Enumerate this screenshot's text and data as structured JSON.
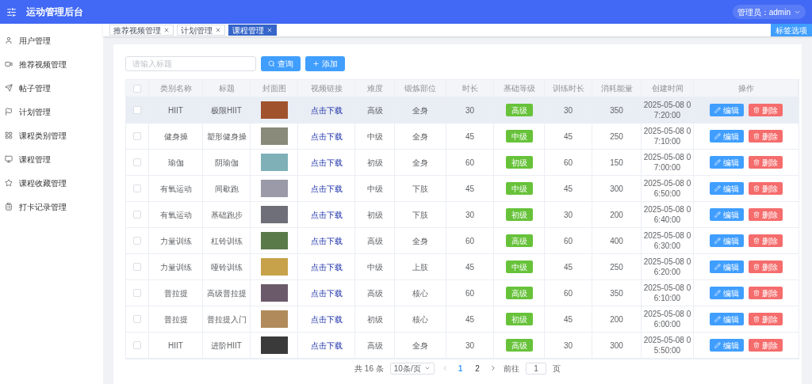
{
  "header": {
    "title": "运动管理后台",
    "user": "管理员：admin"
  },
  "sidebar": {
    "items": [
      {
        "label": "用户管理",
        "selected": false
      },
      {
        "label": "推荐视频管理",
        "selected": false
      },
      {
        "label": "帖子管理",
        "selected": false
      },
      {
        "label": "计划管理",
        "selected": false
      },
      {
        "label": "课程类别管理",
        "selected": false
      },
      {
        "label": "课程管理",
        "selected": false
      },
      {
        "label": "课程收藏管理",
        "selected": false
      },
      {
        "label": "打卡记录管理",
        "selected": false
      }
    ]
  },
  "tabs": [
    {
      "label": "推荐视频管理",
      "selected": false
    },
    {
      "label": "计划管理",
      "selected": false
    },
    {
      "label": "课程管理",
      "selected": true
    }
  ],
  "tab_options_button": "标签选项",
  "toolbar": {
    "search": {
      "placeholder": "请输入标题"
    },
    "query_button": "查询",
    "add_button": "添加"
  },
  "table": {
    "header_checked": false,
    "columns": [
      "类别名称",
      "标题",
      "封面图",
      "视频链接",
      "难度",
      "锻炼部位",
      "时长",
      "基础等级",
      "训练时长",
      "消耗能量",
      "创建时间",
      "操作"
    ],
    "rows": [
      {
        "checked": false,
        "hovered": true,
        "category": "HIIT",
        "title": "极限HIIT",
        "link": "点击下载",
        "difficulty": "高级",
        "body_part": "全身",
        "duration": "30",
        "level_tag": "高级",
        "train_time": "30",
        "calories": "350",
        "created": "2025-05-08 07:20:00",
        "edit": "编辑",
        "delete": "删除"
      },
      {
        "checked": false,
        "hovered": false,
        "category": "健身操",
        "title": "塑形健身操",
        "link": "点击下载",
        "difficulty": "中级",
        "body_part": "全身",
        "duration": "45",
        "level_tag": "中级",
        "train_time": "45",
        "calories": "250",
        "created": "2025-05-08 07:10:00",
        "edit": "编辑",
        "delete": "删除"
      },
      {
        "checked": false,
        "hovered": false,
        "category": "瑜伽",
        "title": "阴瑜伽",
        "link": "点击下载",
        "difficulty": "初级",
        "body_part": "全身",
        "duration": "60",
        "level_tag": "初级",
        "train_time": "60",
        "calories": "150",
        "created": "2025-05-08 07:00:00",
        "edit": "编辑",
        "delete": "删除"
      },
      {
        "checked": false,
        "hovered": false,
        "category": "有氧运动",
        "title": "间歇跑",
        "link": "点击下载",
        "difficulty": "中级",
        "body_part": "下肢",
        "duration": "45",
        "level_tag": "中级",
        "train_time": "45",
        "calories": "300",
        "created": "2025-05-08 06:50:00",
        "edit": "编辑",
        "delete": "删除"
      },
      {
        "checked": false,
        "hovered": false,
        "category": "有氧运动",
        "title": "基础跑步",
        "link": "点击下载",
        "difficulty": "初级",
        "body_part": "下肢",
        "duration": "30",
        "level_tag": "初级",
        "train_time": "30",
        "calories": "200",
        "created": "2025-05-08 06:40:00",
        "edit": "编辑",
        "delete": "删除"
      },
      {
        "checked": false,
        "hovered": false,
        "category": "力量训练",
        "title": "杠铃训练",
        "link": "点击下载",
        "difficulty": "高级",
        "body_part": "全身",
        "duration": "60",
        "level_tag": "高级",
        "train_time": "60",
        "calories": "400",
        "created": "2025-05-08 06:30:00",
        "edit": "编辑",
        "delete": "删除"
      },
      {
        "checked": false,
        "hovered": false,
        "category": "力量训练",
        "title": "哑铃训练",
        "link": "点击下载",
        "difficulty": "中级",
        "body_part": "上肢",
        "duration": "45",
        "level_tag": "中级",
        "train_time": "45",
        "calories": "250",
        "created": "2025-05-08 06:20:00",
        "edit": "编辑",
        "delete": "删除"
      },
      {
        "checked": false,
        "hovered": false,
        "category": "普拉提",
        "title": "高级普拉提",
        "link": "点击下载",
        "difficulty": "高级",
        "body_part": "核心",
        "duration": "60",
        "level_tag": "高级",
        "train_time": "60",
        "calories": "350",
        "created": "2025-05-08 06:10:00",
        "edit": "编辑",
        "delete": "删除"
      },
      {
        "checked": false,
        "hovered": false,
        "category": "普拉提",
        "title": "普拉提入门",
        "link": "点击下载",
        "difficulty": "初级",
        "body_part": "核心",
        "duration": "45",
        "level_tag": "初级",
        "train_time": "45",
        "calories": "200",
        "created": "2025-05-08 06:00:00",
        "edit": "编辑",
        "delete": "删除"
      },
      {
        "checked": false,
        "hovered": false,
        "category": "HIIT",
        "title": "进阶HIIT",
        "link": "点击下载",
        "difficulty": "高级",
        "body_part": "全身",
        "duration": "30",
        "level_tag": "高级",
        "train_time": "30",
        "calories": "300",
        "created": "2025-05-08 05:50:00",
        "edit": "编辑",
        "delete": "删除"
      }
    ]
  },
  "pagination": {
    "total": "共 16 条",
    "page_size": "10条/页",
    "pages": [
      {
        "label": "1",
        "selected": true
      },
      {
        "label": "2",
        "selected": false
      }
    ],
    "goto_label": "前往",
    "goto_value": "1",
    "goto_suffix": "页"
  }
}
